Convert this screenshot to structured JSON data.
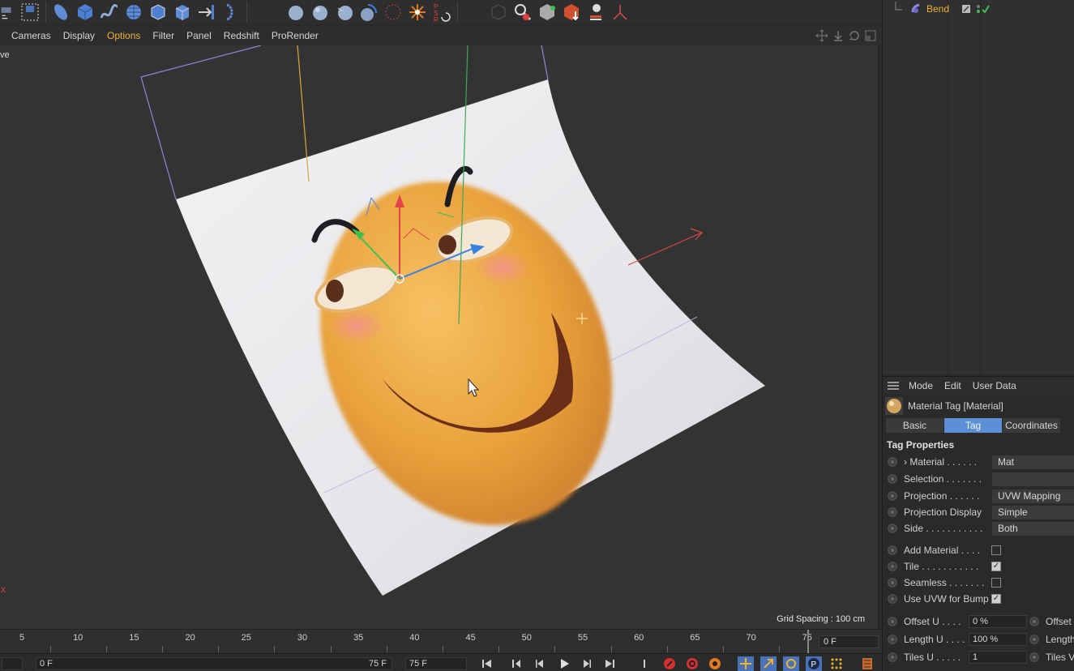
{
  "toolbar": {
    "icons": [
      "render-toggle-icon",
      "render-region-icon",
      "capsule-icon",
      "cube-icon",
      "spline-icon",
      "subdivision-icon",
      "array-icon",
      "extrude-icon",
      "bool-icon",
      "symmetry-icon",
      "sphere-icon",
      "sphere-2-icon",
      "sphere-3-icon",
      "deformer-icon",
      "grid-icon",
      "light-icon",
      "psr-icon",
      "display-icon",
      "paint-icon",
      "mograph-icon",
      "effector-icon",
      "bulb-icon",
      "axis-icon"
    ]
  },
  "view_menu": {
    "items": [
      "Cameras",
      "Display",
      "Options",
      "Filter",
      "Panel",
      "Redshift",
      "ProRender"
    ],
    "active": "Options"
  },
  "viewport": {
    "label": "ve",
    "axis_mark": "x",
    "grid_spacing": "Grid Spacing : 100 cm"
  },
  "timeline": {
    "ticks": [
      "5",
      "10",
      "15",
      "20",
      "25",
      "30",
      "35",
      "40",
      "45",
      "50",
      "55",
      "60",
      "65",
      "70",
      "75"
    ],
    "current_frame": "0 F"
  },
  "transport": {
    "start_field": "0 F",
    "end_field": "75 F",
    "end_field_2": "75 F"
  },
  "object_manager": {
    "object_name": "Bend"
  },
  "attributes": {
    "menu": [
      "Mode",
      "Edit",
      "User Data"
    ],
    "header": "Material Tag [Material]",
    "tabs": [
      "Basic",
      "Tag",
      "Coordinates"
    ],
    "active_tab": "Tag",
    "section": "Tag Properties",
    "fields": [
      {
        "label": "Material . . . . . .",
        "value": "Mat",
        "expand": "›"
      },
      {
        "label": "Selection . . . . . . .",
        "value": ""
      },
      {
        "label": "Projection . . . . . .",
        "value": "UVW Mapping"
      },
      {
        "label": "Projection Display",
        "value": "Simple"
      },
      {
        "label": "Side . . . . . . . . . . .",
        "value": "Both"
      }
    ],
    "checks": [
      {
        "label": "Add Material . . . .",
        "checked": false
      },
      {
        "label": "Tile . . . . . . . . . . .",
        "checked": true
      },
      {
        "label": "Seamless . . . . . . .",
        "checked": false
      },
      {
        "label": "Use UVW for Bump",
        "checked": true
      }
    ],
    "uv": [
      {
        "label": "Offset U . . . .",
        "value": "0 %",
        "label2": "Offset"
      },
      {
        "label": "Length U . . . .",
        "value": "100 %",
        "label2": "Length"
      },
      {
        "label": "Tiles U . . . . .",
        "value": "1",
        "label2": "Tiles V"
      }
    ]
  },
  "colors": {
    "accent_orange": "#f0b030",
    "tab_active": "#5b8fd6",
    "axis_red": "#e04444",
    "axis_green": "#3ec050",
    "axis_blue": "#3a80e0"
  }
}
